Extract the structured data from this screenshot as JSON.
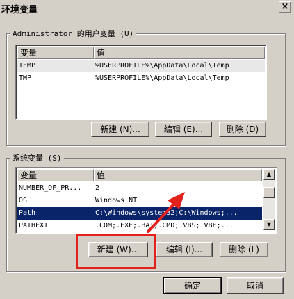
{
  "window": {
    "title": "环境变量",
    "close_glyph": "×"
  },
  "user_vars": {
    "group_label": "Administrator 的用户变量 (U)",
    "col_name": "变量",
    "col_value": "值",
    "rows": [
      {
        "name": "TEMP",
        "value": "%USERPROFILE%\\AppData\\Local\\Temp"
      },
      {
        "name": "TMP",
        "value": "%USERPROFILE%\\AppData\\Local\\Temp"
      }
    ],
    "buttons": {
      "new": "新建 (N)...",
      "edit": "编辑 (E)...",
      "delete": "删除 (D)"
    }
  },
  "system_vars": {
    "group_label": "系统变量 (S)",
    "col_name": "变量",
    "col_value": "值",
    "rows": [
      {
        "name": "NUMBER_OF_PR...",
        "value": "2"
      },
      {
        "name": "OS",
        "value": "Windows_NT"
      },
      {
        "name": "Path",
        "value": "C:\\Windows\\system32;C:\\Windows;..."
      },
      {
        "name": "PATHEXT",
        "value": ".COM;.EXE;.BAT;.CMD;.VBS;.VBE;..."
      }
    ],
    "buttons": {
      "new": "新建 (W)...",
      "edit": "编辑 (I)...",
      "delete": "删除 (L)"
    }
  },
  "dialog_buttons": {
    "ok": "确定",
    "cancel": "取消"
  },
  "annotation": {
    "color": "#e3201b"
  },
  "icons": {
    "scroll_up": "▲",
    "scroll_down": "▼"
  }
}
